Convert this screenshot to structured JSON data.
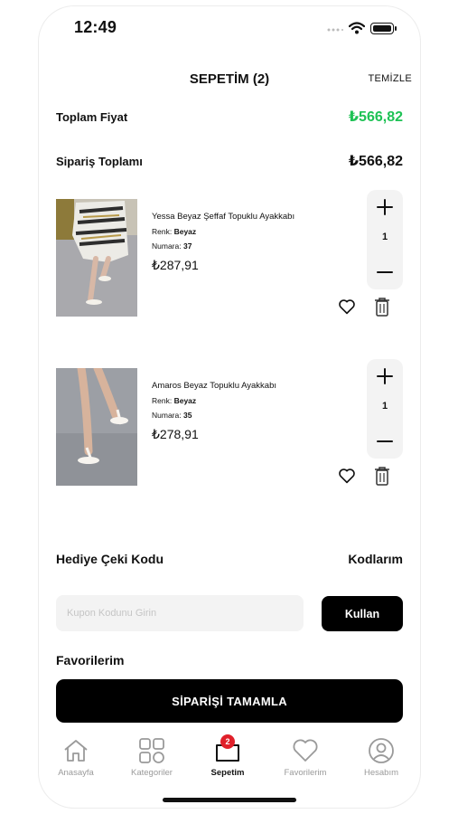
{
  "status_bar": {
    "time": "12:49"
  },
  "header": {
    "title": "SEPETİM (2)",
    "clear_label": "TEMİZLE"
  },
  "summary": {
    "total_label": "Toplam Fiyat",
    "total_value": "₺566,82",
    "order_label": "Sipariş Toplamı",
    "order_value": "₺566,82"
  },
  "cart_items": [
    {
      "name": "Yessa Beyaz Şeffaf Topuklu Ayakkabı",
      "color_label": "Renk:",
      "color_value": "Beyaz",
      "size_label": "Numara:",
      "size_value": "37",
      "price": "₺287,91",
      "quantity": "1"
    },
    {
      "name": "Amaros Beyaz Topuklu Ayakkabı",
      "color_label": "Renk:",
      "color_value": "Beyaz",
      "size_label": "Numara:",
      "size_value": "35",
      "price": "₺278,91",
      "quantity": "1"
    }
  ],
  "gift": {
    "label": "Hediye Çeki Kodu",
    "codes_link": "Kodlarım",
    "input_placeholder": "Kupon Kodunu Girin",
    "apply_label": "Kullan"
  },
  "favorites_heading": "Favorilerim",
  "complete_label": "SİPARİŞİ TAMAMLA",
  "tabs": [
    {
      "label": "Anasayfa",
      "icon": "home-icon"
    },
    {
      "label": "Kategoriler",
      "icon": "grid-icon"
    },
    {
      "label": "Sepetim",
      "icon": "cart-icon",
      "badge": "2",
      "active": true
    },
    {
      "label": "Favorilerim",
      "icon": "heart-icon"
    },
    {
      "label": "Hesabım",
      "icon": "profile-icon"
    }
  ],
  "colors": {
    "accent_green": "#1ec255",
    "badge_red": "#e0202a",
    "primary_black": "#000000",
    "muted_gray": "#9a9a9a"
  }
}
